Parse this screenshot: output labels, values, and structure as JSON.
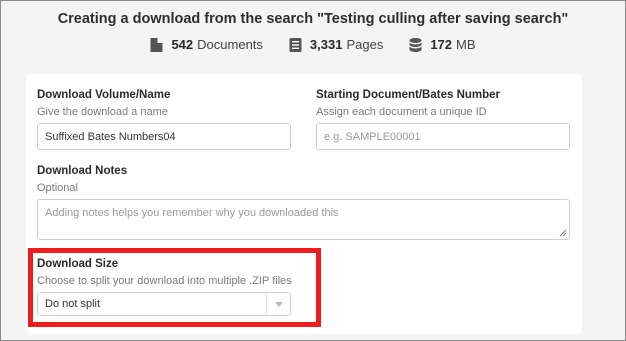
{
  "header": {
    "title": "Creating a download from the search \"Testing culling after saving search\"",
    "stats": {
      "documents_count": "542",
      "documents_label": "Documents",
      "pages_count": "3,331",
      "pages_label": "Pages",
      "size_value": "172",
      "size_unit": "MB"
    }
  },
  "form": {
    "volume": {
      "label": "Download Volume/Name",
      "hint": "Give the download a name",
      "value": "Suffixed Bates Numbers04"
    },
    "bates": {
      "label": "Starting Document/Bates Number",
      "hint": "Assign each document a unique ID",
      "placeholder": "e.g. SAMPLE00001"
    },
    "notes": {
      "label": "Download Notes",
      "hint": "Optional",
      "placeholder": "Adding notes helps you remember why you downloaded this"
    },
    "size": {
      "label": "Download Size",
      "hint": "Choose to split your download into multiple .ZIP files",
      "selected": "Do not split"
    }
  },
  "annotation": {
    "highlight_color": "#ee1c1c"
  },
  "icons": [
    "document-icon",
    "pages-icon",
    "database-icon",
    "chevron-down-icon",
    "resize-handle-icon"
  ]
}
